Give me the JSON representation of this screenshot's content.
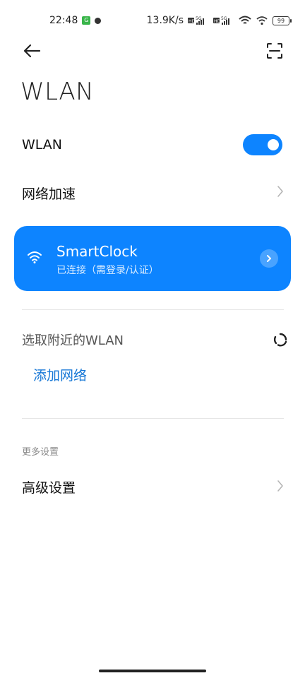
{
  "status_bar": {
    "time": "22:48",
    "badge_text": "G",
    "net_speed": "13.9K/s",
    "hd1": "HD",
    "sig1_tech": "5G",
    "hd2": "HD",
    "sig2_tech": "5G",
    "battery": "99"
  },
  "page": {
    "title": "WLAN"
  },
  "wlan_toggle": {
    "label": "WLAN",
    "on": true
  },
  "network_acceleration": {
    "label": "网络加速"
  },
  "connected_network": {
    "name": "SmartClock",
    "status": "已连接（需登录/认证）"
  },
  "nearby": {
    "label": "选取附近的WLAN",
    "add_network": "添加网络"
  },
  "more_settings": {
    "section_label": "更多设置",
    "advanced_label": "高级设置"
  },
  "colors": {
    "accent": "#0d84ff",
    "link": "#1677d6"
  }
}
